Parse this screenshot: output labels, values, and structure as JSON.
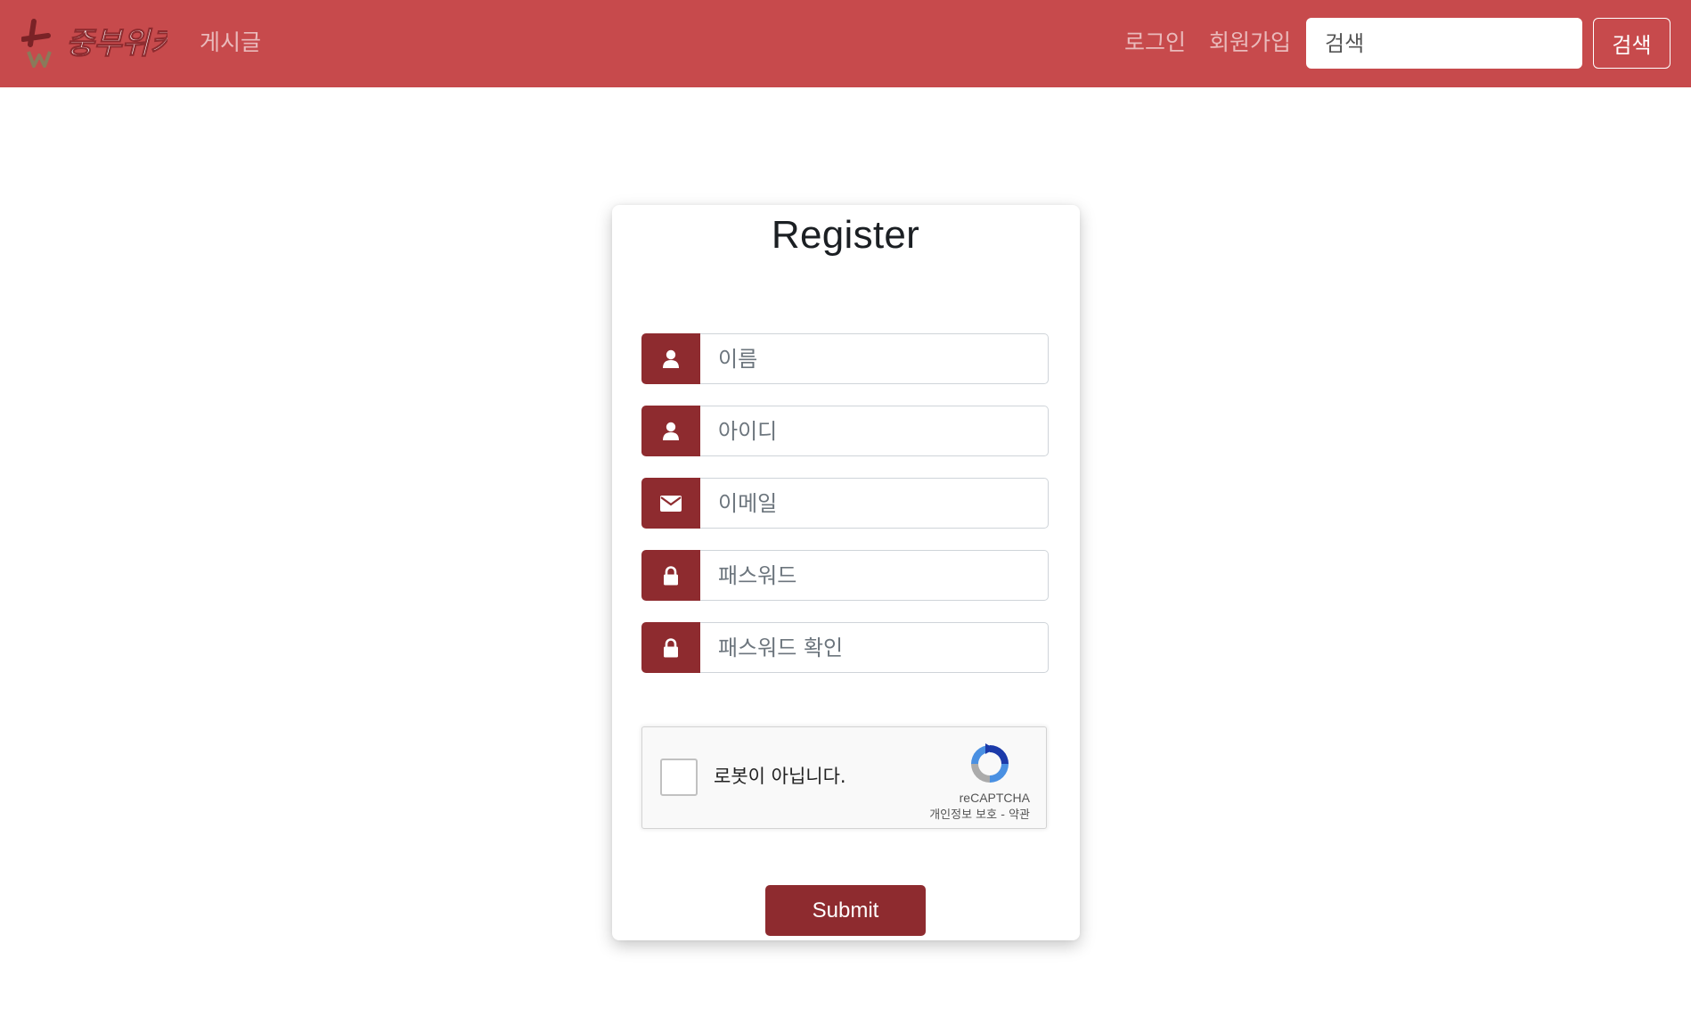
{
  "header": {
    "logo_text": "중부위키",
    "nav": {
      "posts": "게시글",
      "login": "로그인",
      "signup": "회원가입"
    },
    "search": {
      "placeholder": "검색",
      "button_label": "검색"
    }
  },
  "form": {
    "title": "Register",
    "fields": [
      {
        "icon": "user-icon",
        "placeholder": "이름"
      },
      {
        "icon": "user-icon",
        "placeholder": "아이디"
      },
      {
        "icon": "envelope-icon",
        "placeholder": "이메일"
      },
      {
        "icon": "lock-icon",
        "placeholder": "패스워드"
      },
      {
        "icon": "lock-icon",
        "placeholder": "패스워드 확인"
      }
    ],
    "recaptcha": {
      "label": "로봇이 아닙니다.",
      "brand": "reCAPTCHA",
      "privacy": "개인정보 보호",
      "separator": " - ",
      "terms": "약관"
    },
    "submit_label": "Submit"
  },
  "colors": {
    "navbar": "#c74a4c",
    "accent": "#8e2b2f",
    "card_background": "#ffffff"
  }
}
